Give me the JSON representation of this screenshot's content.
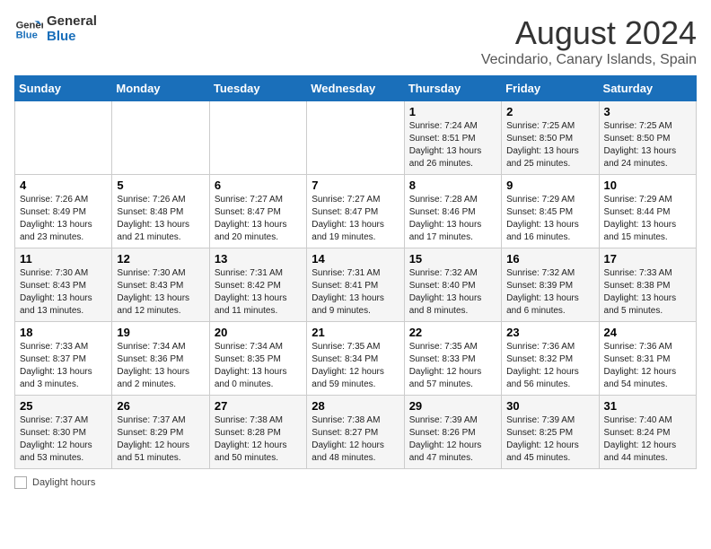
{
  "logo": {
    "line1": "General",
    "line2": "Blue"
  },
  "title": "August 2024",
  "subtitle": "Vecindario, Canary Islands, Spain",
  "days_header": [
    "Sunday",
    "Monday",
    "Tuesday",
    "Wednesday",
    "Thursday",
    "Friday",
    "Saturday"
  ],
  "legend_label": "Daylight hours",
  "weeks": [
    [
      {
        "day": "",
        "info": ""
      },
      {
        "day": "",
        "info": ""
      },
      {
        "day": "",
        "info": ""
      },
      {
        "day": "",
        "info": ""
      },
      {
        "day": "1",
        "info": "Sunrise: 7:24 AM\nSunset: 8:51 PM\nDaylight: 13 hours and 26 minutes."
      },
      {
        "day": "2",
        "info": "Sunrise: 7:25 AM\nSunset: 8:50 PM\nDaylight: 13 hours and 25 minutes."
      },
      {
        "day": "3",
        "info": "Sunrise: 7:25 AM\nSunset: 8:50 PM\nDaylight: 13 hours and 24 minutes."
      }
    ],
    [
      {
        "day": "4",
        "info": "Sunrise: 7:26 AM\nSunset: 8:49 PM\nDaylight: 13 hours and 23 minutes."
      },
      {
        "day": "5",
        "info": "Sunrise: 7:26 AM\nSunset: 8:48 PM\nDaylight: 13 hours and 21 minutes."
      },
      {
        "day": "6",
        "info": "Sunrise: 7:27 AM\nSunset: 8:47 PM\nDaylight: 13 hours and 20 minutes."
      },
      {
        "day": "7",
        "info": "Sunrise: 7:27 AM\nSunset: 8:47 PM\nDaylight: 13 hours and 19 minutes."
      },
      {
        "day": "8",
        "info": "Sunrise: 7:28 AM\nSunset: 8:46 PM\nDaylight: 13 hours and 17 minutes."
      },
      {
        "day": "9",
        "info": "Sunrise: 7:29 AM\nSunset: 8:45 PM\nDaylight: 13 hours and 16 minutes."
      },
      {
        "day": "10",
        "info": "Sunrise: 7:29 AM\nSunset: 8:44 PM\nDaylight: 13 hours and 15 minutes."
      }
    ],
    [
      {
        "day": "11",
        "info": "Sunrise: 7:30 AM\nSunset: 8:43 PM\nDaylight: 13 hours and 13 minutes."
      },
      {
        "day": "12",
        "info": "Sunrise: 7:30 AM\nSunset: 8:43 PM\nDaylight: 13 hours and 12 minutes."
      },
      {
        "day": "13",
        "info": "Sunrise: 7:31 AM\nSunset: 8:42 PM\nDaylight: 13 hours and 11 minutes."
      },
      {
        "day": "14",
        "info": "Sunrise: 7:31 AM\nSunset: 8:41 PM\nDaylight: 13 hours and 9 minutes."
      },
      {
        "day": "15",
        "info": "Sunrise: 7:32 AM\nSunset: 8:40 PM\nDaylight: 13 hours and 8 minutes."
      },
      {
        "day": "16",
        "info": "Sunrise: 7:32 AM\nSunset: 8:39 PM\nDaylight: 13 hours and 6 minutes."
      },
      {
        "day": "17",
        "info": "Sunrise: 7:33 AM\nSunset: 8:38 PM\nDaylight: 13 hours and 5 minutes."
      }
    ],
    [
      {
        "day": "18",
        "info": "Sunrise: 7:33 AM\nSunset: 8:37 PM\nDaylight: 13 hours and 3 minutes."
      },
      {
        "day": "19",
        "info": "Sunrise: 7:34 AM\nSunset: 8:36 PM\nDaylight: 13 hours and 2 minutes."
      },
      {
        "day": "20",
        "info": "Sunrise: 7:34 AM\nSunset: 8:35 PM\nDaylight: 13 hours and 0 minutes."
      },
      {
        "day": "21",
        "info": "Sunrise: 7:35 AM\nSunset: 8:34 PM\nDaylight: 12 hours and 59 minutes."
      },
      {
        "day": "22",
        "info": "Sunrise: 7:35 AM\nSunset: 8:33 PM\nDaylight: 12 hours and 57 minutes."
      },
      {
        "day": "23",
        "info": "Sunrise: 7:36 AM\nSunset: 8:32 PM\nDaylight: 12 hours and 56 minutes."
      },
      {
        "day": "24",
        "info": "Sunrise: 7:36 AM\nSunset: 8:31 PM\nDaylight: 12 hours and 54 minutes."
      }
    ],
    [
      {
        "day": "25",
        "info": "Sunrise: 7:37 AM\nSunset: 8:30 PM\nDaylight: 12 hours and 53 minutes."
      },
      {
        "day": "26",
        "info": "Sunrise: 7:37 AM\nSunset: 8:29 PM\nDaylight: 12 hours and 51 minutes."
      },
      {
        "day": "27",
        "info": "Sunrise: 7:38 AM\nSunset: 8:28 PM\nDaylight: 12 hours and 50 minutes."
      },
      {
        "day": "28",
        "info": "Sunrise: 7:38 AM\nSunset: 8:27 PM\nDaylight: 12 hours and 48 minutes."
      },
      {
        "day": "29",
        "info": "Sunrise: 7:39 AM\nSunset: 8:26 PM\nDaylight: 12 hours and 47 minutes."
      },
      {
        "day": "30",
        "info": "Sunrise: 7:39 AM\nSunset: 8:25 PM\nDaylight: 12 hours and 45 minutes."
      },
      {
        "day": "31",
        "info": "Sunrise: 7:40 AM\nSunset: 8:24 PM\nDaylight: 12 hours and 44 minutes."
      }
    ]
  ]
}
